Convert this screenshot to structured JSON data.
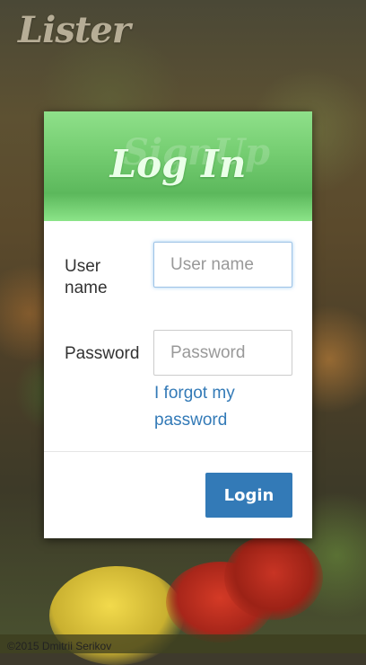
{
  "app": {
    "logo_text": "Lister"
  },
  "modal": {
    "title": "Log In",
    "ghost_title": "SignUp",
    "username_label": "User name",
    "username_placeholder": "User name",
    "password_label": "Password",
    "password_placeholder": "Password",
    "forgot_link": "I forgot my password",
    "login_button": "Login"
  },
  "footer": {
    "copyright": "©2015 Dmitrii Serikov"
  },
  "colors": {
    "header_green": "#5cb85c",
    "primary_blue": "#337ab7",
    "link_blue": "#337ab7"
  }
}
